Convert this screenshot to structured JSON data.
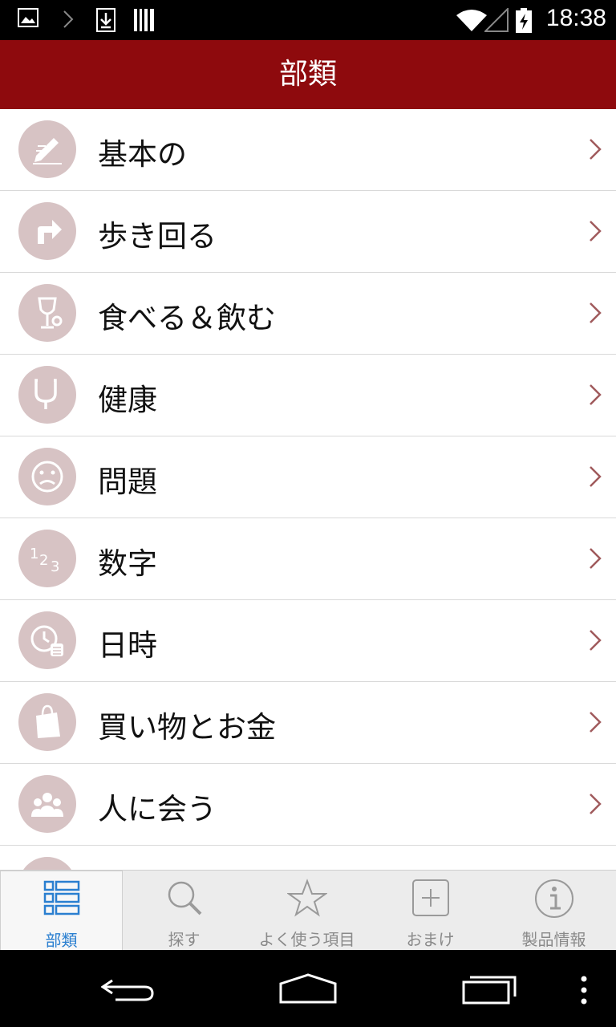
{
  "status": {
    "time": "18:38"
  },
  "header": {
    "title": "部類"
  },
  "list": {
    "items": [
      {
        "label": "基本の",
        "icon": "pencil-icon"
      },
      {
        "label": "歩き回る",
        "icon": "turn-right-arrow-icon"
      },
      {
        "label": "食べる＆飲む",
        "icon": "wine-glass-icon"
      },
      {
        "label": "健康",
        "icon": "stethoscope-icon"
      },
      {
        "label": "問題",
        "icon": "sad-face-icon"
      },
      {
        "label": "数字",
        "icon": "numbers-icon"
      },
      {
        "label": "日時",
        "icon": "clock-calendar-icon"
      },
      {
        "label": "買い物とお金",
        "icon": "shopping-bag-icon"
      },
      {
        "label": "人に会う",
        "icon": "people-icon"
      }
    ]
  },
  "tabs": [
    {
      "label": "部類",
      "icon": "category-list-icon",
      "active": true
    },
    {
      "label": "探す",
      "icon": "search-icon",
      "active": false
    },
    {
      "label": "よく使う項目",
      "icon": "star-icon",
      "active": false
    },
    {
      "label": "おまけ",
      "icon": "plus-box-icon",
      "active": false
    },
    {
      "label": "製品情報",
      "icon": "info-icon",
      "active": false
    }
  ],
  "colors": {
    "header_bg": "#8e0a0d",
    "icon_circle": "#d7c3c4",
    "chevron": "#a05a5c",
    "active_tab": "#2a7fd0"
  }
}
